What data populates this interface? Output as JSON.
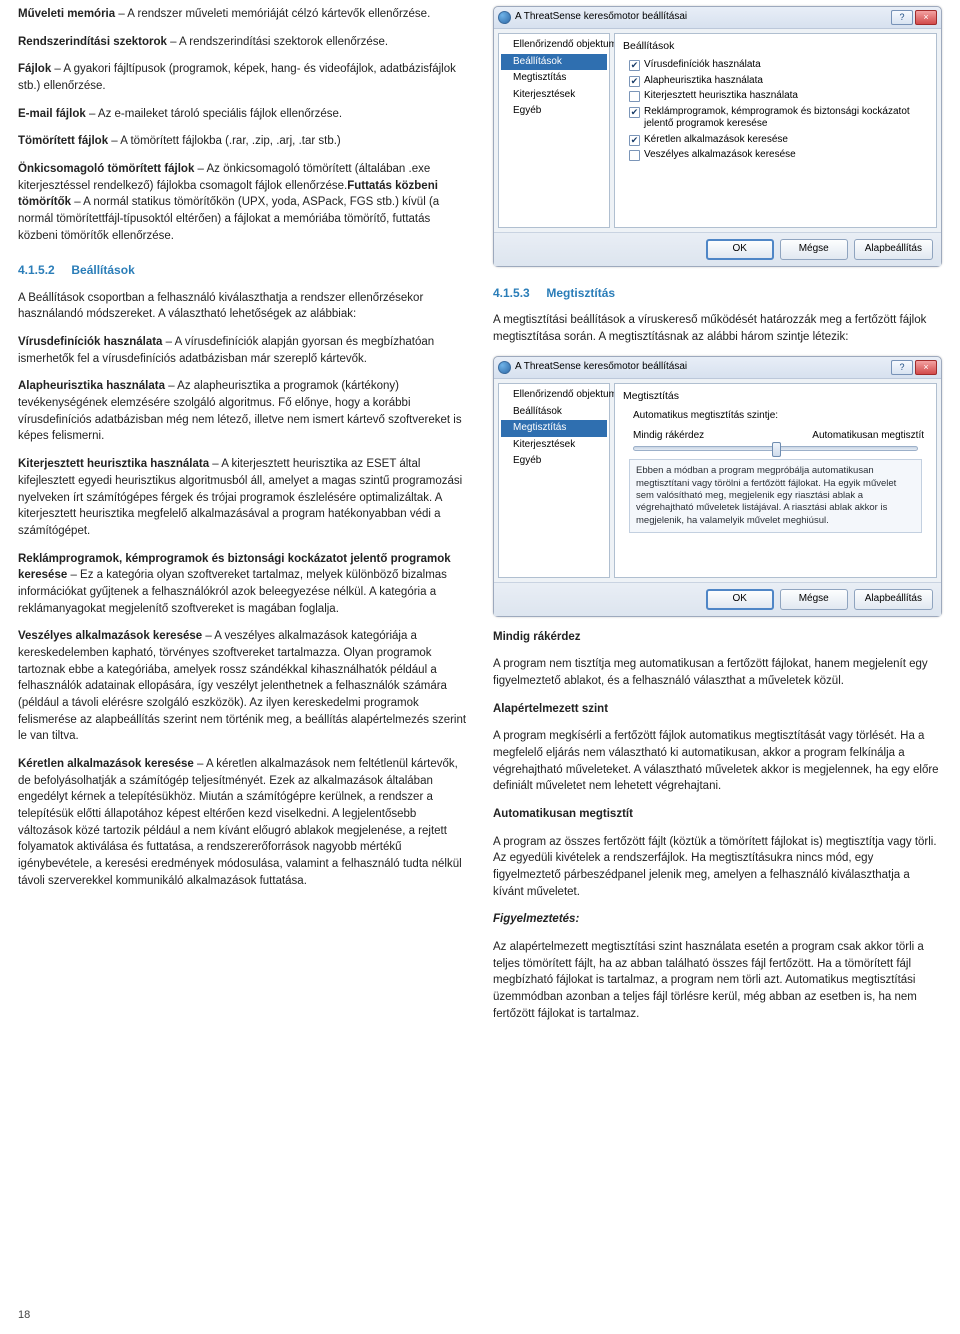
{
  "col1": {
    "p1_strong": "Műveleti memória",
    "p1_rest": " – A rendszer műveleti memóriáját célzó kártevők ellenőrzése.",
    "p2_strong": "Rendszerindítási szektorok",
    "p2_rest": " – A rendszerindítási szektorok ellenőrzése.",
    "p3_strong": "Fájlok",
    "p3_rest": " – A gyakori fájltípusok (programok, képek, hang- és videofájlok, adatbázisfájlok stb.) ellenőrzése.",
    "p4_strong": "E-mail fájlok",
    "p4_rest": " – Az e-maileket tároló speciális fájlok ellenőrzése.",
    "p5_strong": "Tömörített fájlok",
    "p5_rest": " – A tömörített fájlokba (.rar, .zip, .arj, .tar stb.)",
    "p6_strong1": "Önkicsomagoló tömörített fájlok",
    "p6_mid1": " – Az önkicsomagoló tömörített (általában .exe kiterjesztéssel rendelkező) fájlokba csomagolt fájlok ellenőrzése.",
    "p6_strong2": "Futtatás közbeni tömörítők",
    "p6_mid2": " – A normál statikus tömörítőkön (UPX, yoda, ASPack, FGS stb.) kívül (a normál tömörítettfájl-típusoktól eltérően) a fájlokat a memóriába tömörítő, futtatás közbeni tömörítők ellenőrzése.",
    "sect_4152_num": "4.1.5.2",
    "sect_4152_title": "Beállítások",
    "p7": "A Beállítások csoportban a felhasználó kiválaszthatja a rendszer ellenőrzésekor használandó módszereket. A választható lehetőségek az alábbiak:",
    "p8_strong": "Vírusdefiníciók használata",
    "p8_rest": " – A vírusdefiníciók alapján gyorsan és megbízhatóan ismerhetők fel a vírusdefiníciós adatbázisban már szereplő kártevők.",
    "p9_strong": "Alapheurisztika használata",
    "p9_rest": " – Az alapheurisztika a programok (kártékony) tevékenységének elemzésére szolgáló algoritmus. Fő előnye, hogy a korábbi vírusdefiníciós adatbázisban még nem létező, illetve nem ismert kártevő szoftvereket is képes felismerni.",
    "p10_strong": "Kiterjesztett heurisztika használata",
    "p10_rest": " – A kiterjesztett heurisztika az ESET által kifejlesztett egyedi heurisztikus algoritmusból áll, amelyet a magas szintű programozási nyelveken írt számítógépes férgek és trójai programok észlelésére optimalizáltak. A kiterjesztett heurisztika megfelelő alkalmazásával a program hatékonyabban védi a számítógépet.",
    "p11_strong": "Reklámprogramok, kémprogramok és biztonsági kockázatot jelentő programok keresése",
    "p11_rest": " – Ez a kategória olyan szoftvereket tartalmaz, melyek különböző bizalmas információkat gyűjtenek a felhasználókról azok beleegyezése nélkül. A kategória a reklámanyagokat megjelenítő szoftvereket is magában foglalja.",
    "p12_strong": "Veszélyes alkalmazások keresése",
    "p12_rest": " – A veszélyes alkalmazások kategóriája a kereskedelemben kapható, törvényes szoftvereket tartalmazza. Olyan programok tartoznak ebbe a kategóriába, amelyek rossz szándékkal kihasználhatók például a felhasználók adatainak ellopására, így veszélyt jelenthetnek a felhasználók számára (például a távoli elérésre szolgáló eszközök). Az ilyen kereskedelmi programok felismerése az alapbeállítás szerint nem történik meg, a beállítás alapértelmezés szerint le van tiltva.",
    "p13_strong": "Kéretlen alkalmazások keresése",
    "p13_rest": " – A kéretlen alkalmazások nem feltétlenül kártevők, de befolyásolhatják a számítógép teljesítményét. Ezek az alkalmazások általában engedélyt kérnek a telepítésükhöz. Miután a számítógépre kerülnek, a rendszer a telepítésük előtti állapotához képest eltérően kezd viselkedni. A legjelentősebb változások közé tartozik például a nem kívánt előugró ablakok megjelenése, a rejtett folyamatok aktiválása és futtatása, a rendszererőforrások nagyobb mértékű igénybevétele, a keresési eredmények módosulása, valamint a felhasználó tudta nélkül távoli szerverekkel kommunikáló alkalmazások futtatása."
  },
  "dlg1": {
    "title": "A ThreatSense keresőmotor beállításai",
    "help": "?",
    "close": "×",
    "tree": [
      "Ellenőrizendő objektumok",
      "Beállítások",
      "Megtisztítás",
      "Kiterjesztések",
      "Egyéb"
    ],
    "tree_sel": 1,
    "group": "Beállítások",
    "opts": [
      {
        "checked": true,
        "label": "Vírusdefiníciók használata"
      },
      {
        "checked": true,
        "label": "Alapheurisztika használata"
      },
      {
        "checked": false,
        "label": "Kiterjesztett heurisztika használata"
      },
      {
        "checked": true,
        "label": "Reklámprogramok, kémprogramok és biztonsági kockázatot jelentő programok keresése"
      },
      {
        "checked": true,
        "label": "Kéretlen alkalmazások keresése"
      },
      {
        "checked": false,
        "label": "Veszélyes alkalmazások keresése"
      }
    ],
    "btn_ok": "OK",
    "btn_cancel": "Mégse",
    "btn_default": "Alapbeállítás"
  },
  "col2": {
    "sect_4153_num": "4.1.5.3",
    "sect_4153_title": "Megtisztítás",
    "p1": "A megtisztítási beállítások a víruskereső működését határozzák meg a fertőzött fájlok megtisztítása során. A megtisztításnak az alábbi három szintje létezik:",
    "h1": "Mindig rákérdez",
    "p2": "A program nem tisztítja meg automatikusan a fertőzött fájlokat, hanem megjelenít egy figyelmeztető ablakot, és a felhasználó választhat a műveletek közül.",
    "h2": "Alapértelmezett szint",
    "p3": "A program megkísérli a fertőzött fájlok automatikus megtisztítását vagy törlését. Ha a megfelelő eljárás nem választható ki automatikusan, akkor a program felkínálja a végrehajtható műveleteket. A választható műveletek akkor is megjelennek, ha egy előre definiált műveletet nem lehetett végrehajtani.",
    "h3": "Automatikusan megtisztít",
    "p4": "A program az összes fertőzött fájlt (köztük a tömörített fájlokat is) megtisztítja vagy törli. Az egyedüli kivételek a rendszerfájlok. Ha megtisztításukra nincs mód, egy figyelmeztető párbeszédpanel jelenik meg, amelyen a felhasználó kiválaszthatja a kívánt műveletet.",
    "warn_h": "Figyelmeztetés:",
    "warn_p": "Az alapértelmezett megtisztítási szint használata esetén a program csak akkor törli a teljes tömörített fájlt, ha az abban található összes fájl fertőzött. Ha a tömörített fájl megbízható fájlokat is tartalmaz, a program nem törli azt. Automatikus megtisztítási üzemmódban azonban a teljes fájl törlésre kerül, még abban az esetben is, ha nem fertőzött fájlokat is tartalmaz."
  },
  "dlg2": {
    "title": "A ThreatSense keresőmotor beállításai",
    "tree": [
      "Ellenőrizendő objektumok",
      "Beállítások",
      "Megtisztítás",
      "Kiterjesztések",
      "Egyéb"
    ],
    "tree_sel": 2,
    "group": "Megtisztítás",
    "levellbl": "Automatikus megtisztítás szintje:",
    "slider_left": "Mindig rákérdez",
    "slider_right": "Automatikusan megtisztít",
    "desc": "Ebben a módban a program megpróbálja automatikusan megtisztítani vagy törölni a fertőzött fájlokat. Ha egyik művelet sem valósítható meg, megjelenik egy riasztási ablak a végrehajtható műveletek listájával. A riasztási ablak akkor is megjelenik, ha valamelyik művelet meghiúsul.",
    "btn_ok": "OK",
    "btn_cancel": "Mégse",
    "btn_default": "Alapbeállítás"
  },
  "page_num": "18"
}
